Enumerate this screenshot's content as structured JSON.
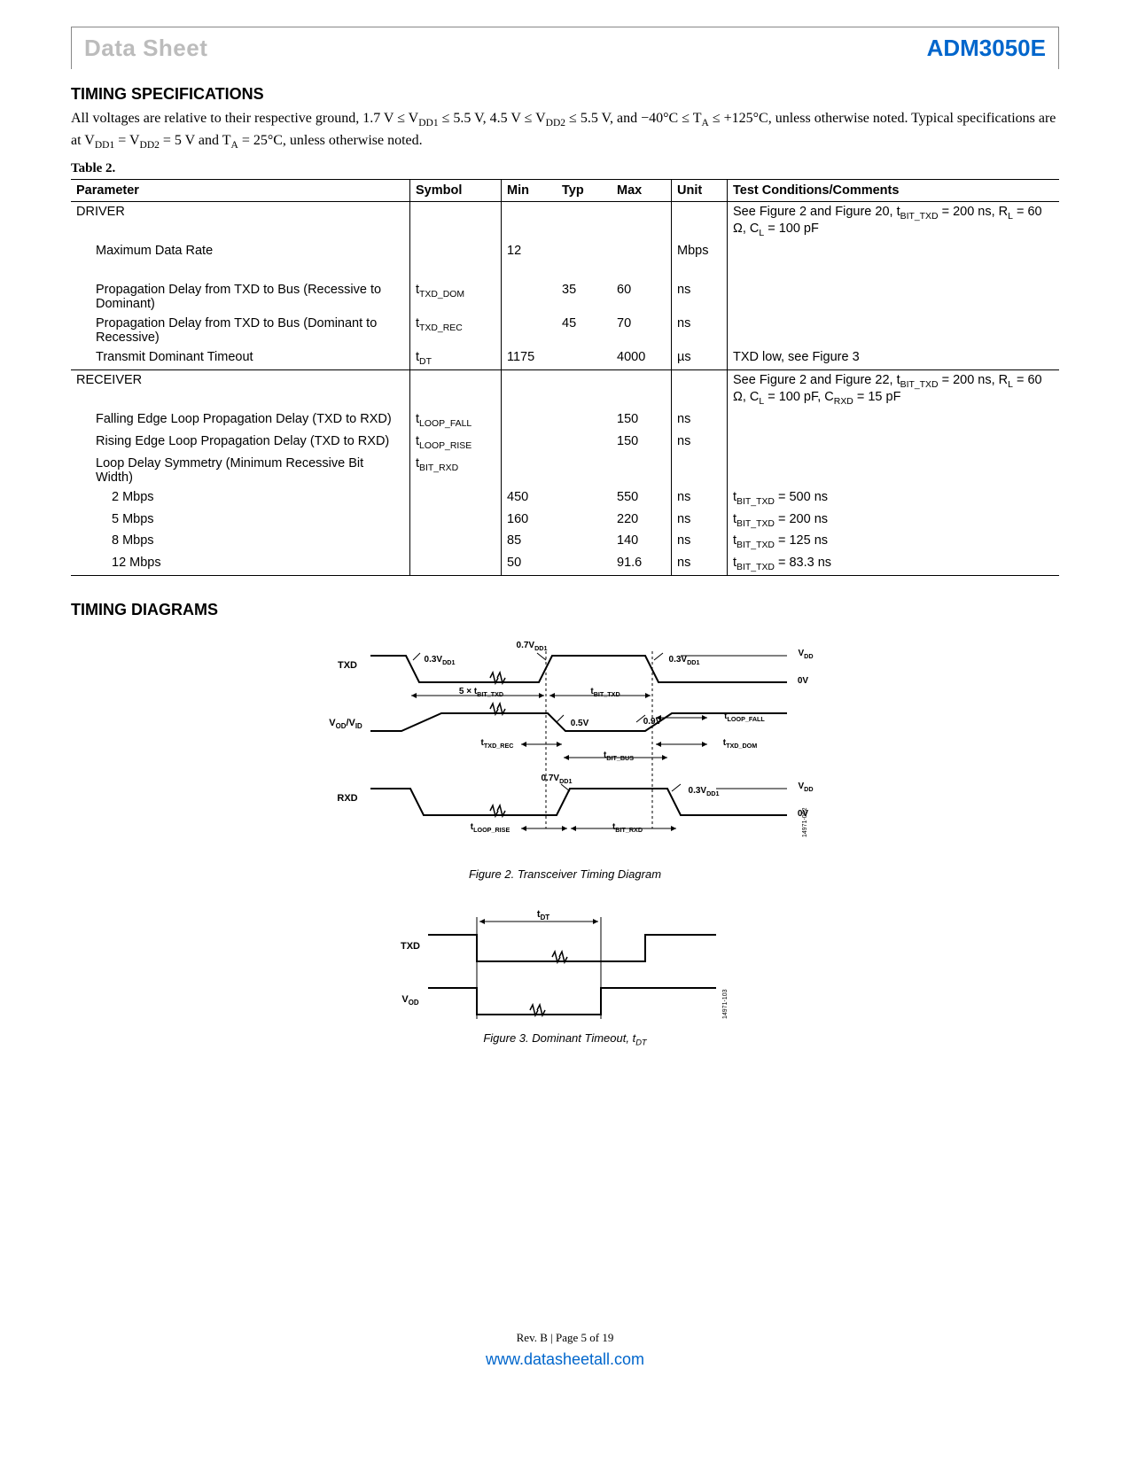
{
  "header": {
    "left": "Data Sheet",
    "right": "ADM3050E"
  },
  "section1_heading": "TIMING SPECIFICATIONS",
  "intro_html": "All voltages are relative to their respective ground, 1.7 V ≤ V<sub>DD1</sub> ≤ 5.5 V, 4.5 V ≤ V<sub>DD2</sub> ≤ 5.5 V, and −40°C ≤ T<sub>A</sub> ≤ +125°C, unless otherwise noted. Typical specifications are at V<sub>DD1</sub> = V<sub>DD2</sub> = 5 V and T<sub>A</sub> = 25°C, unless otherwise noted.",
  "table_label": "Table 2.",
  "table_headers": [
    "Parameter",
    "Symbol",
    "Min",
    "Typ",
    "Max",
    "Unit",
    "Test Conditions/Comments"
  ],
  "rows": [
    {
      "cls": "section-row",
      "param": "DRIVER",
      "indent": 0,
      "symbol": "",
      "min": "",
      "typ": "",
      "max": "",
      "unit": "",
      "test": "See Figure 2 and Figure 20, t<sub>BIT_TXD</sub> = 200 ns, R<sub>L</sub> = 60 Ω, C<sub>L</sub> = 100 pF"
    },
    {
      "cls": "",
      "param": "Maximum Data Rate",
      "indent": 1,
      "symbol": "",
      "min": "12",
      "typ": "",
      "max": "",
      "unit": "Mbps",
      "test": ""
    },
    {
      "cls": "spacer",
      "param": "",
      "indent": 0,
      "symbol": "",
      "min": "",
      "typ": "",
      "max": "",
      "unit": "",
      "test": ""
    },
    {
      "cls": "",
      "param": "Propagation Delay from TXD to Bus (Recessive to Dominant)",
      "indent": 1,
      "symbol": "t<sub>TXD_DOM</sub>",
      "min": "",
      "typ": "35",
      "max": "60",
      "unit": "ns",
      "test": ""
    },
    {
      "cls": "",
      "param": "Propagation Delay from TXD to Bus (Dominant to Recessive)",
      "indent": 1,
      "symbol": "t<sub>TXD_REC</sub>",
      "min": "",
      "typ": "45",
      "max": "70",
      "unit": "ns",
      "test": ""
    },
    {
      "cls": "",
      "param": "Transmit Dominant Timeout",
      "indent": 1,
      "symbol": "t<sub>DT</sub>",
      "min": "1175",
      "typ": "",
      "max": "4000",
      "unit": "µs",
      "test": "TXD low, see Figure 3"
    },
    {
      "cls": "section-row",
      "param": "RECEIVER",
      "indent": 0,
      "symbol": "",
      "min": "",
      "typ": "",
      "max": "",
      "unit": "",
      "test": "See Figure 2 and Figure 22, t<sub>BIT_TXD</sub> = 200 ns, R<sub>L</sub> = 60 Ω, C<sub>L</sub> = 100 pF, C<sub>RXD</sub> = 15 pF"
    },
    {
      "cls": "",
      "param": "Falling Edge Loop Propagation Delay (TXD to RXD)",
      "indent": 1,
      "symbol": "t<sub>LOOP_FALL</sub>",
      "min": "",
      "typ": "",
      "max": "150",
      "unit": "ns",
      "test": ""
    },
    {
      "cls": "",
      "param": "Rising Edge Loop Propagation Delay (TXD to RXD)",
      "indent": 1,
      "symbol": "t<sub>LOOP_RISE</sub>",
      "min": "",
      "typ": "",
      "max": "150",
      "unit": "ns",
      "test": ""
    },
    {
      "cls": "",
      "param": "Loop Delay Symmetry (Minimum Recessive Bit Width)",
      "indent": 1,
      "symbol": "t<sub>BIT_RXD</sub>",
      "min": "",
      "typ": "",
      "max": "",
      "unit": "",
      "test": ""
    },
    {
      "cls": "",
      "param": "2 Mbps",
      "indent": 2,
      "symbol": "",
      "min": "450",
      "typ": "",
      "max": "550",
      "unit": "ns",
      "test": "t<sub>BIT_TXD</sub> = 500 ns"
    },
    {
      "cls": "",
      "param": "5 Mbps",
      "indent": 2,
      "symbol": "",
      "min": "160",
      "typ": "",
      "max": "220",
      "unit": "ns",
      "test": "t<sub>BIT_TXD</sub> = 200 ns"
    },
    {
      "cls": "",
      "param": "8 Mbps",
      "indent": 2,
      "symbol": "",
      "min": "85",
      "typ": "",
      "max": "140",
      "unit": "ns",
      "test": "t<sub>BIT_TXD</sub> = 125 ns"
    },
    {
      "cls": "last-row",
      "param": "12 Mbps",
      "indent": 2,
      "symbol": "",
      "min": "50",
      "typ": "",
      "max": "91.6",
      "unit": "ns",
      "test": "t<sub>BIT_TXD</sub> = 83.3 ns"
    }
  ],
  "section2_heading": "TIMING DIAGRAMS",
  "fig2": {
    "caption": "Figure 2. Transceiver Timing Diagram",
    "labels": {
      "txd": "TXD",
      "vod_vid": "V<sub>OD</sub>/V<sub>ID</sub>",
      "rxd": "RXD",
      "vdd1": "V<sub>DD1</sub>",
      "zero": "0V",
      "p7vdd1": "0.7V<sub>DD1</sub>",
      "p3vdd1": "0.3V<sub>DD1</sub>",
      "p5v": "0.5V",
      "p9v": "0.9V",
      "five_tbit": "5 × t<sub>BIT_TXD</sub>",
      "tbit_txd": "t<sub>BIT_TXD</sub>",
      "tloop_fall": "t<sub>LOOP_FALL</sub>",
      "ttxd_rec": "t<sub>TXD_REC</sub>",
      "ttxd_dom": "t<sub>TXD_DOM</sub>",
      "tbit_bus": "t<sub>BIT_BUS</sub>",
      "tbit_rxd": "t<sub>BIT_RXD</sub>",
      "tloop_rise": "t<sub>LOOP_RISE</sub>",
      "ref": "14971-002"
    }
  },
  "fig3": {
    "caption": "Figure 3. Dominant Timeout, t<sub>DT</sub>",
    "labels": {
      "txd": "TXD",
      "vod": "V<sub>OD</sub>",
      "tdt": "t<sub>DT</sub>",
      "ref": "14971-103"
    }
  },
  "footer": {
    "rev": "Rev. B | Page 5 of 19",
    "link": "www.datasheetall.com"
  }
}
